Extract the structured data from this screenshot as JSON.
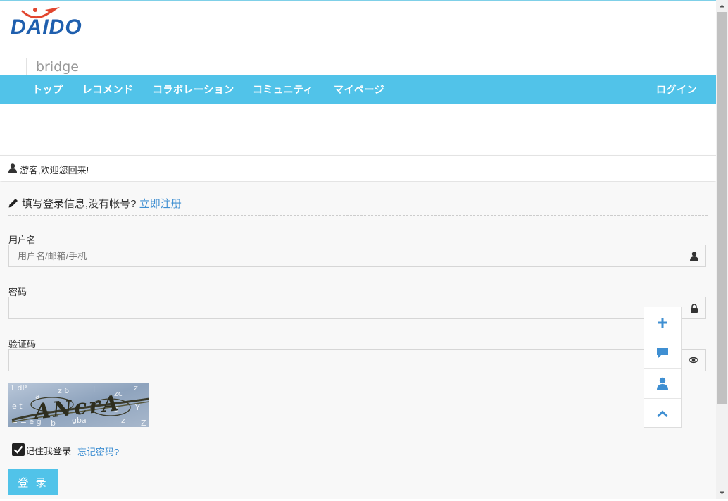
{
  "brand": {
    "logo_text": "DAIDO",
    "site_name": "bridge"
  },
  "nav": {
    "items": [
      "トップ",
      "レコメンド",
      "コラボレーション",
      "コミュニティ",
      "マイページ"
    ],
    "login": "ログイン"
  },
  "welcome": {
    "text": "游客,欢迎您回来!"
  },
  "form": {
    "title": "填写登录信息,没有帐号?",
    "register_link": "立即注册",
    "username": {
      "label": "用户名",
      "placeholder": "用户名/邮箱/手机",
      "value": ""
    },
    "password": {
      "label": "密码",
      "value": ""
    },
    "captcha": {
      "label": "验证码",
      "value": "",
      "image_text": "ANcrA"
    },
    "remember": {
      "label": "记住我登录",
      "checked": true
    },
    "forgot_link": "忘记密码?",
    "submit": "登 录"
  },
  "float_toolbar": [
    "plus-icon",
    "comment-icon",
    "user-icon",
    "chevron-up-icon"
  ],
  "colors": {
    "accent": "#51c3e9",
    "link": "#3f8fd2",
    "logo_blue": "#1f5fae",
    "logo_red": "#e2462f"
  }
}
